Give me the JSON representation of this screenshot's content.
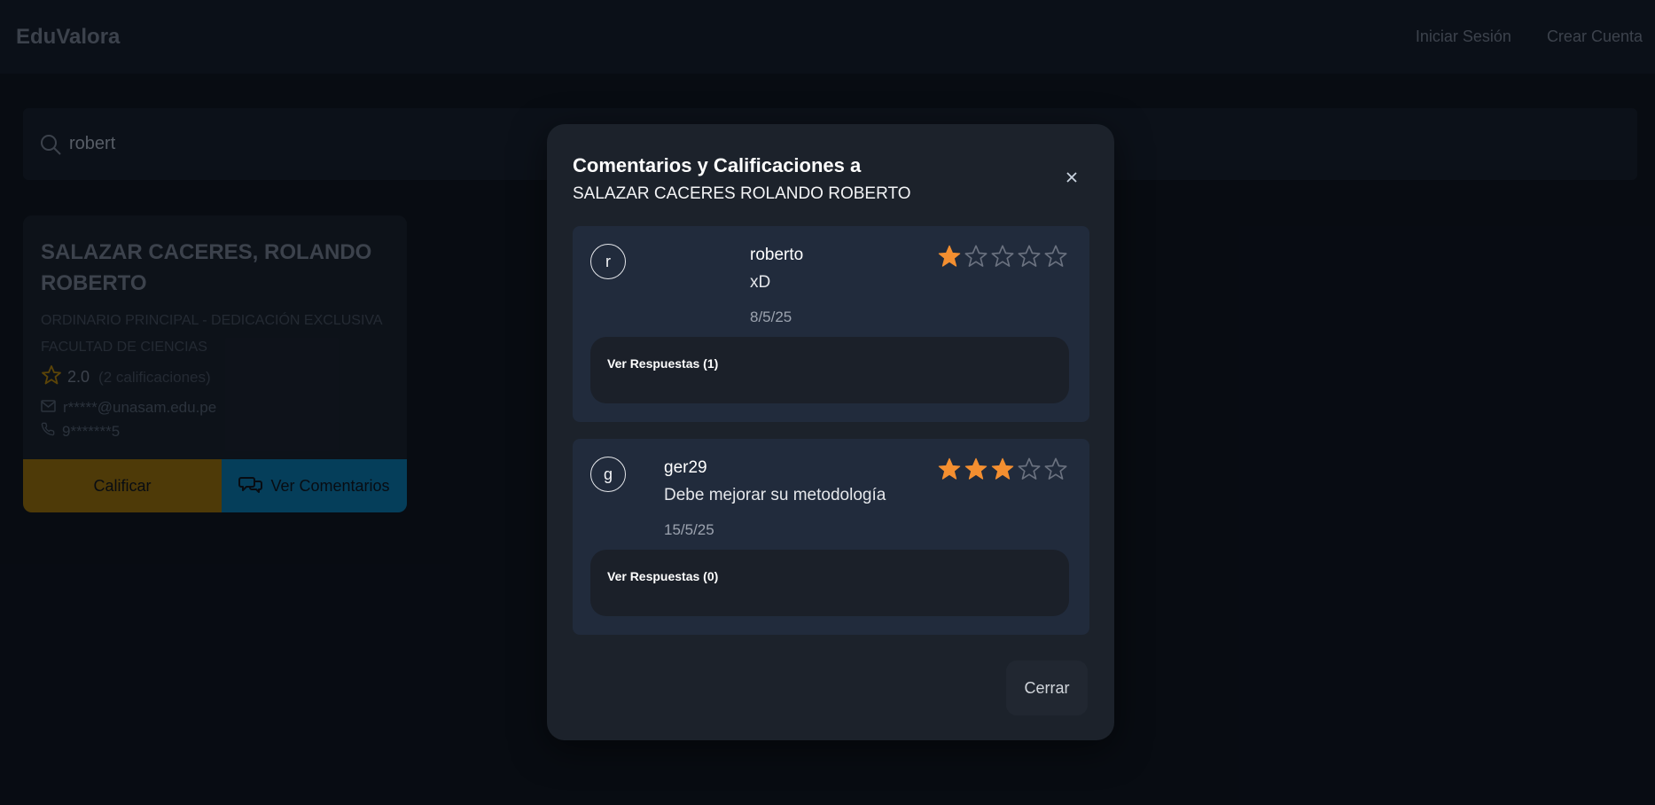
{
  "header": {
    "brand": "EduValora",
    "nav": {
      "login": "Iniciar Sesión",
      "signup": "Crear Cuenta"
    }
  },
  "search": {
    "value": "robert"
  },
  "card": {
    "name": "SALAZAR CACERES, ROLANDO ROBERTO",
    "category": "ORDINARIO PRINCIPAL - DEDICACIÓN EXCLUSIVA",
    "faculty": "FACULTAD DE CIENCIAS",
    "rating": "2.0",
    "rating_count": "(2 calificaciones)",
    "email": "r*****@unasam.edu.pe",
    "phone": "9*******5",
    "rate_label": "Calificar",
    "comments_label": "Ver Comentarios",
    "colors": {
      "rate": "#8a6305",
      "comments": "#066a99"
    }
  },
  "modal": {
    "title": "Comentarios y Calificaciones a",
    "subtitle": "SALAZAR CACERES ROLANDO ROBERTO",
    "close_icon": "close-icon",
    "close_button": "Cerrar",
    "star_color": "#f48f30",
    "comments": [
      {
        "initial": "r",
        "user": "roberto",
        "text": "xD",
        "date": "8/5/25",
        "stars": 1,
        "replies_label": "Ver Respuestas (1)"
      },
      {
        "initial": "g",
        "user": "ger29",
        "text": "Debe mejorar su metodología",
        "date": "15/5/25",
        "stars": 3,
        "replies_label": "Ver Respuestas (0)"
      }
    ]
  }
}
